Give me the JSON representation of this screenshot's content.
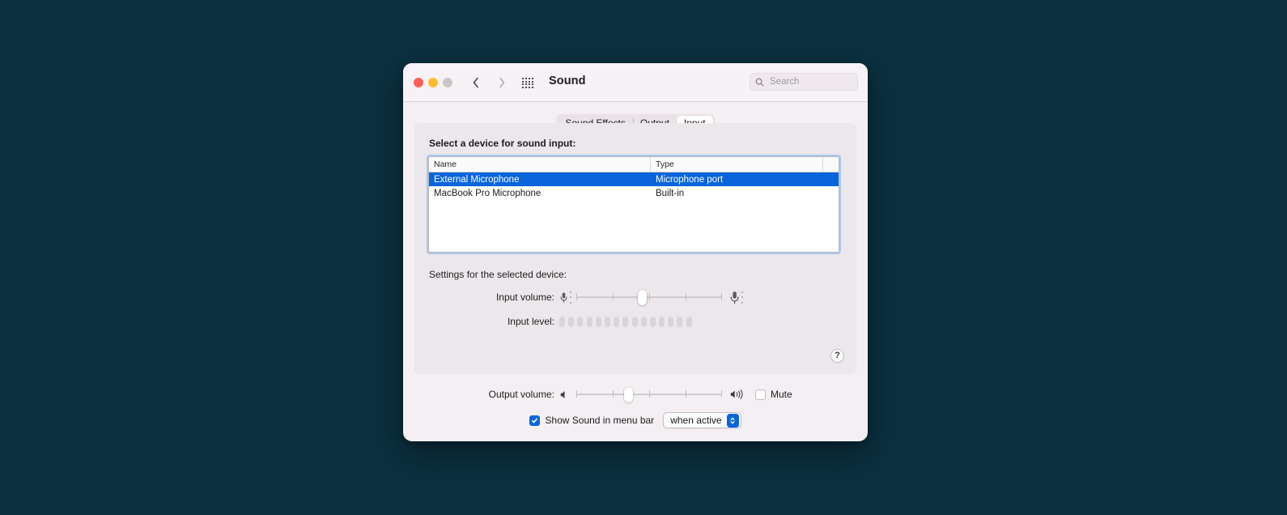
{
  "window": {
    "title": "Sound",
    "traffic_lights": [
      "close",
      "minimize",
      "zoom"
    ],
    "nav_back_icon": "chevron-left-icon",
    "nav_forward_icon": "chevron-right-icon",
    "grid_icon": "grid-apps-icon"
  },
  "search": {
    "placeholder": "Search",
    "value": "",
    "icon": "search-icon"
  },
  "tabs": [
    {
      "label": "Sound Effects",
      "active": false
    },
    {
      "label": "Output",
      "active": false
    },
    {
      "label": "Input",
      "active": true
    }
  ],
  "panel": {
    "select_label": "Select a device for sound input:",
    "settings_label": "Settings for the selected device:",
    "help_label": "?"
  },
  "table": {
    "columns": [
      "Name",
      "Type"
    ],
    "rows": [
      {
        "name": "External Microphone",
        "type": "Microphone port",
        "selected": true
      },
      {
        "name": "MacBook Pro Microphone",
        "type": "Built-in",
        "selected": false
      }
    ]
  },
  "input_volume": {
    "label": "Input volume:",
    "value_percent": 45,
    "tick_count": 5,
    "left_icon": "microphone-small-icon",
    "right_icon": "microphone-large-icon"
  },
  "input_level": {
    "label": "Input level:",
    "segment_count": 15,
    "active_segments": 0
  },
  "output_volume": {
    "label": "Output volume:",
    "value_percent": 35,
    "tick_count": 5,
    "left_icon": "speaker-low-icon",
    "right_icon": "speaker-high-icon"
  },
  "mute": {
    "label": "Mute",
    "checked": false
  },
  "menu_bar": {
    "label": "Show Sound in menu bar",
    "checked": true,
    "select_value": "when active",
    "select_icon": "stepper-updown-icon"
  },
  "colors": {
    "desktop": "#0b303f",
    "window": "#f4eff2",
    "panel": "#ece7ea",
    "accent": "#0a65dc",
    "focus_ring": "#a8c8ec",
    "text": "#1d1d1f"
  }
}
